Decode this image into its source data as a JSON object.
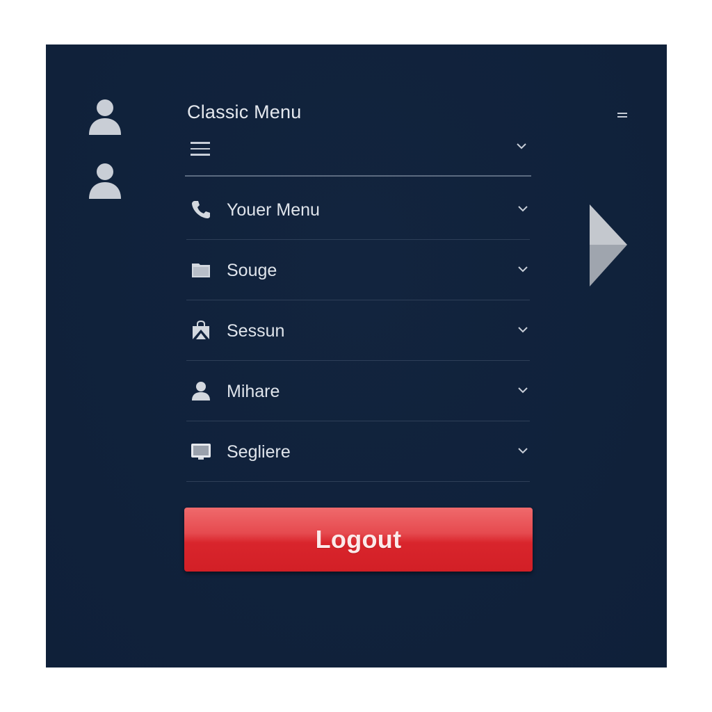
{
  "menu": {
    "title": "Classic Menu",
    "items": [
      {
        "label": "Youer Menu",
        "icon": "phone-icon"
      },
      {
        "label": "Souge",
        "icon": "folder-icon"
      },
      {
        "label": "Sessun",
        "icon": "shopping-bag-icon"
      },
      {
        "label": "Mihare",
        "icon": "user-icon"
      },
      {
        "label": "Segliere",
        "icon": "monitor-icon"
      }
    ]
  },
  "logout": {
    "label": "Logout"
  },
  "colors": {
    "panel_background": "#12243e",
    "text": "#dfe4eb",
    "logout_button": "#d9252c"
  }
}
